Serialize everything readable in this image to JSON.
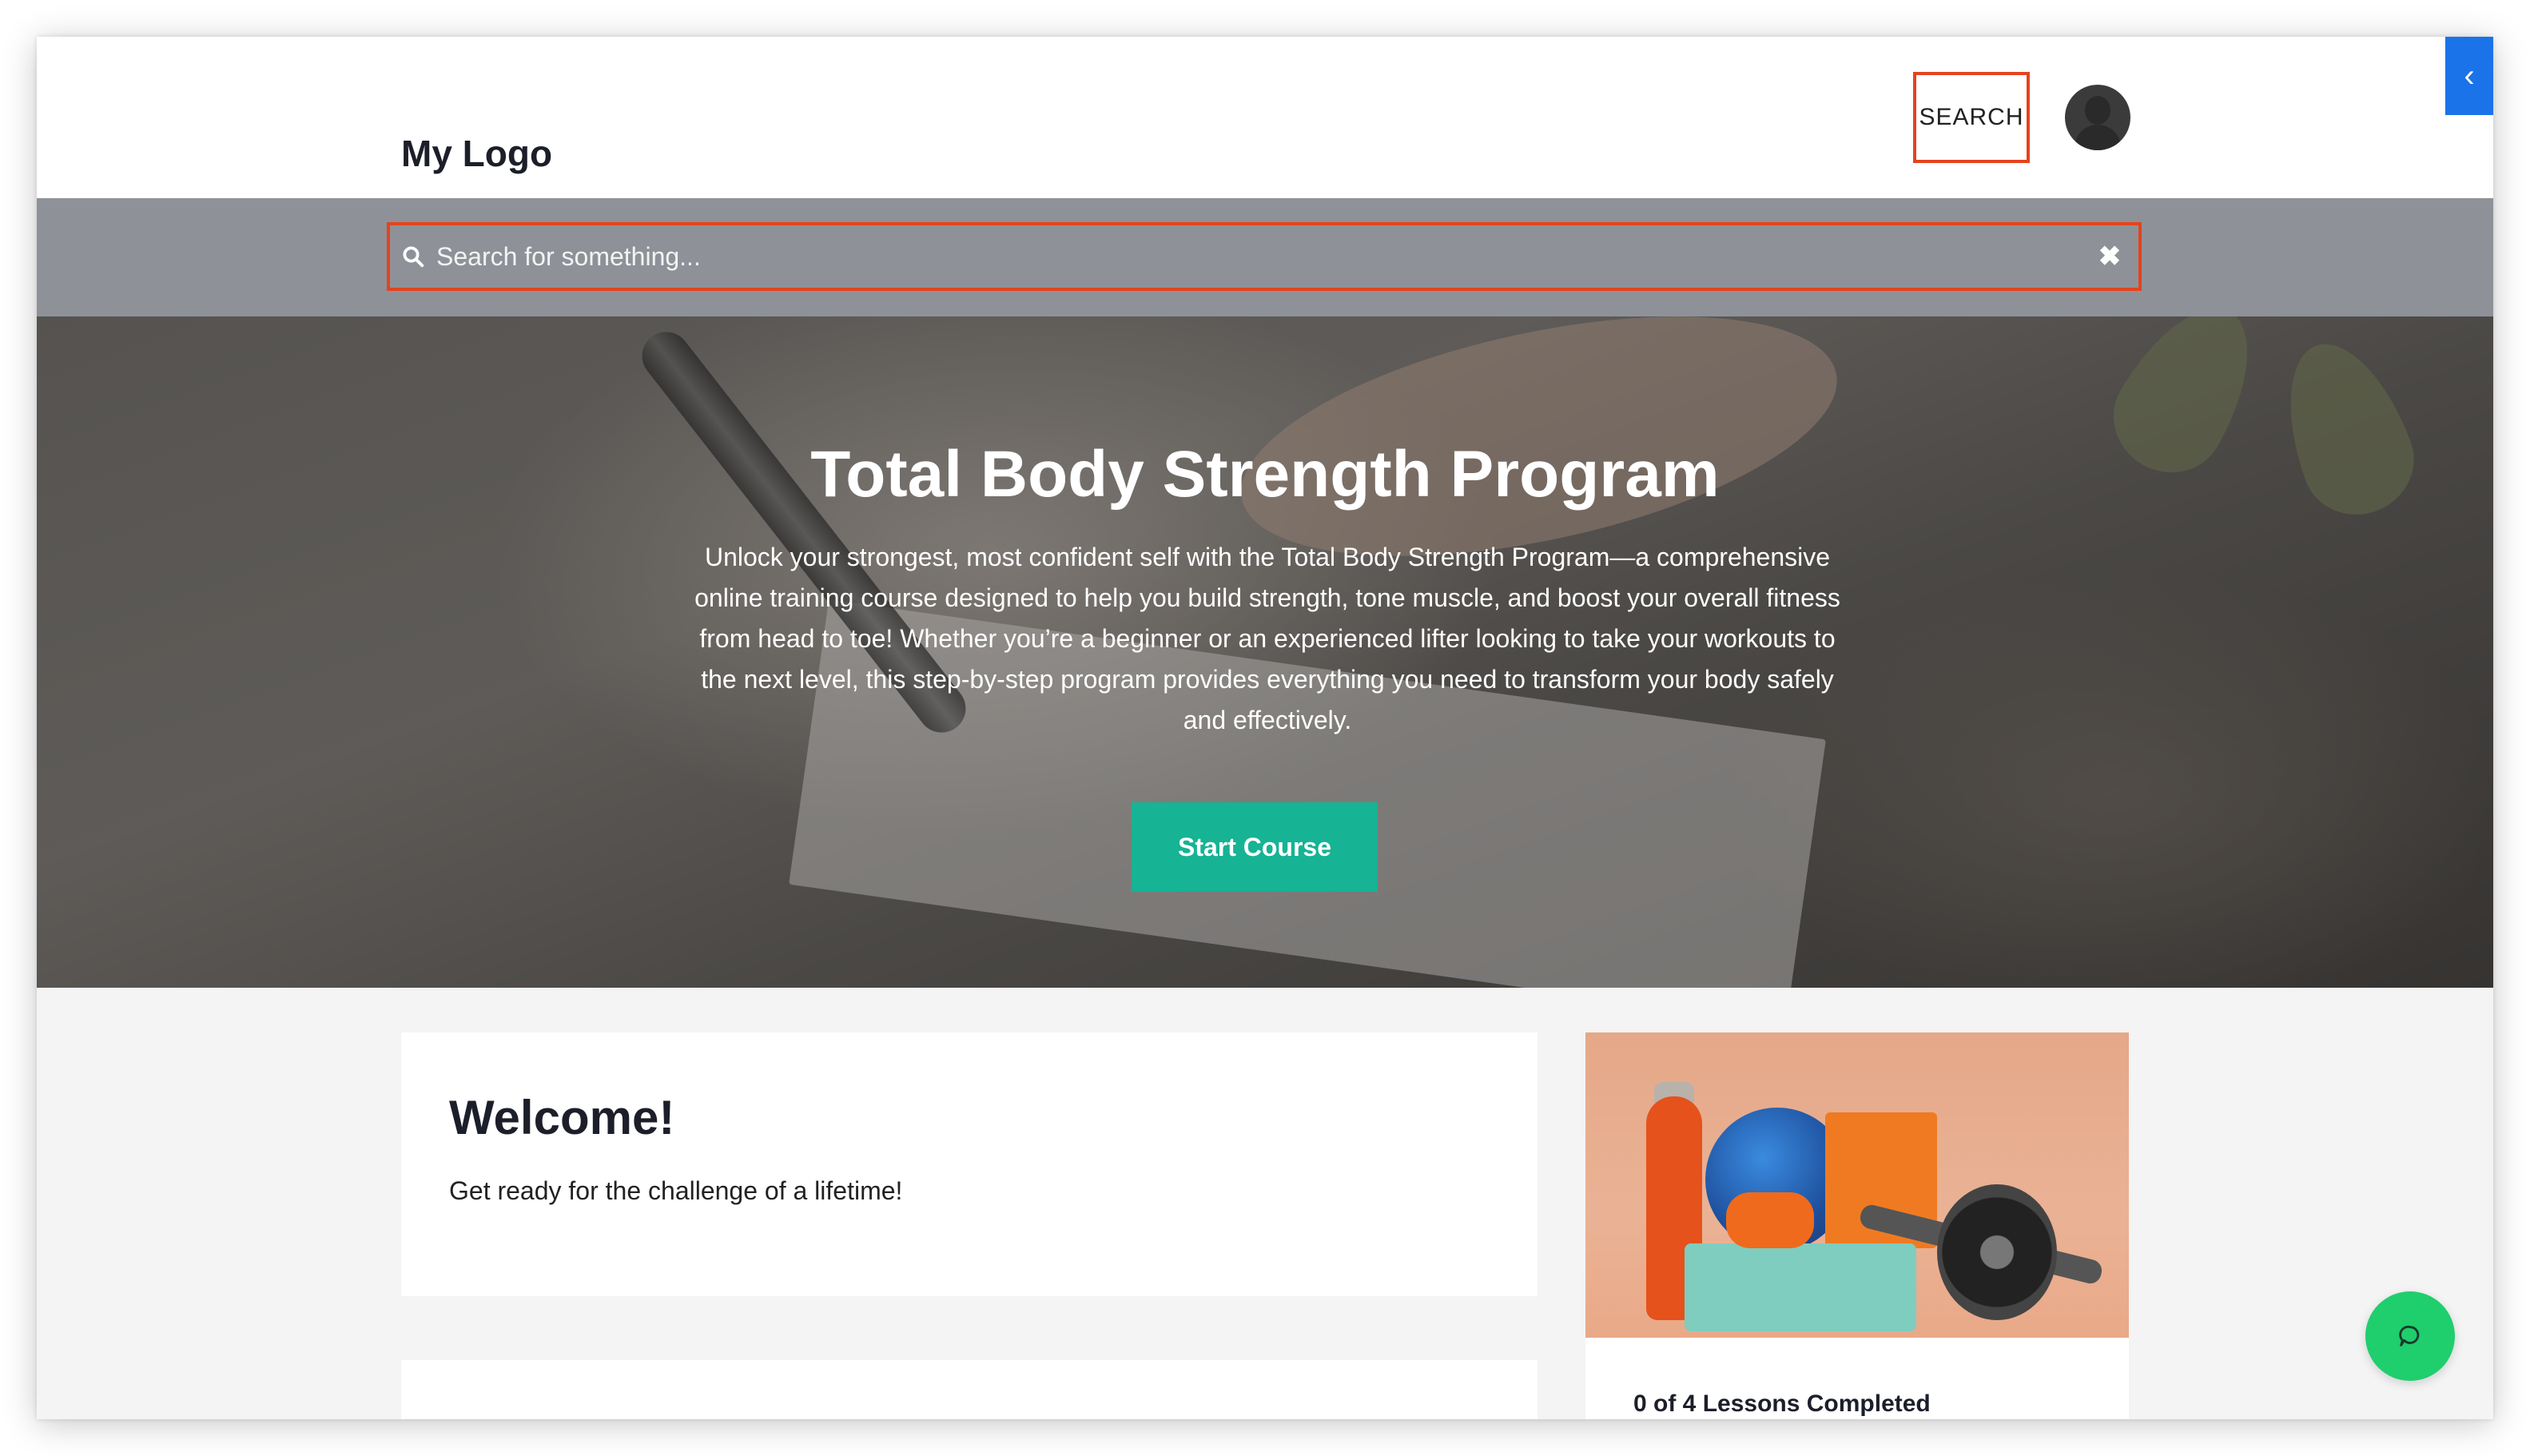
{
  "header": {
    "logo_text": "My Logo",
    "search_label": "SEARCH"
  },
  "search": {
    "placeholder": "Search for something..."
  },
  "hero": {
    "title": "Total Body Strength Program",
    "description": "Unlock your strongest, most confident self with the Total Body Strength Program—a comprehensive online training course designed to help you build strength, tone muscle, and boost your overall fitness from head to toe! Whether you’re a beginner or an experienced lifter looking to take your workouts to the next level, this step-by-step program provides everything you need to transform your body safely and effectively.",
    "cta_label": "Start Course"
  },
  "welcome": {
    "heading": "Welcome!",
    "text": "Get ready for the challenge of a lifetime!"
  },
  "course": {
    "progress_text": "0 of 4 Lessons Completed",
    "lessons_completed": 0,
    "lessons_total": 4
  },
  "colors": {
    "accent": "#16b394",
    "highlight": "#e5431e",
    "side_toggle": "#1a73e8",
    "chat": "#1fce6d"
  },
  "icons": {
    "search": "magnifier-icon",
    "clear": "close-icon",
    "side_toggle": "chevron-left-icon",
    "chat": "chat-bubble-icon",
    "avatar": "user-avatar-icon"
  }
}
